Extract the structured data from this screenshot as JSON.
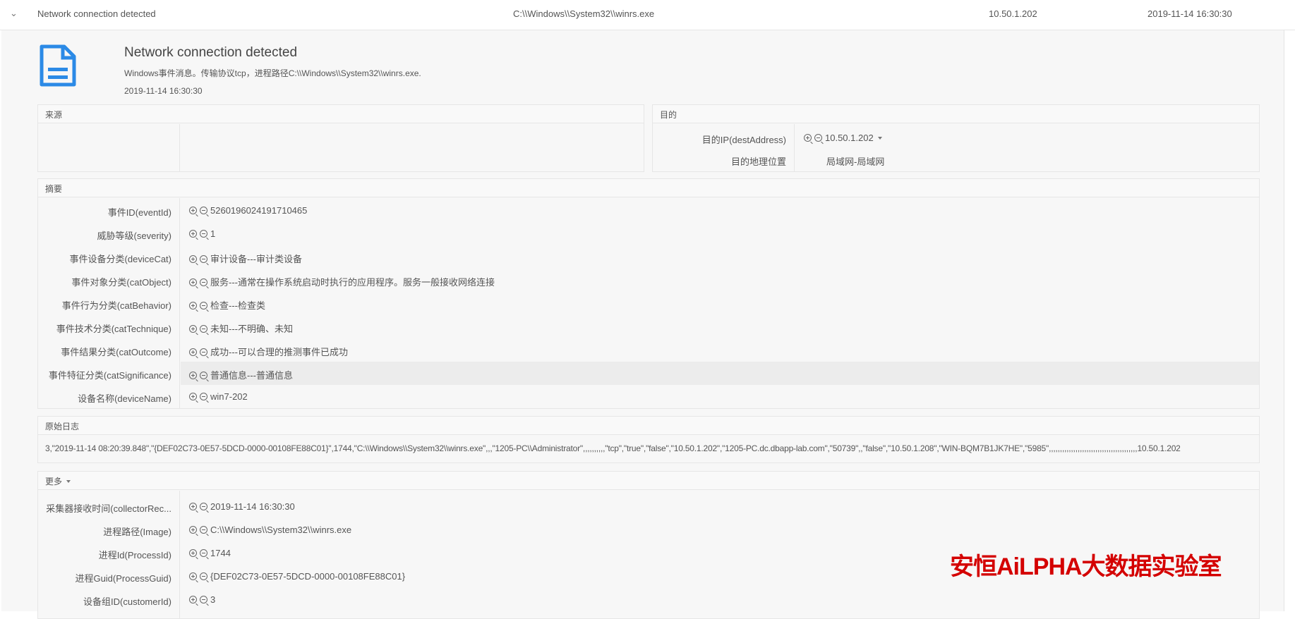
{
  "row": {
    "title": "Network connection detected",
    "path": "C:\\\\Windows\\\\System32\\\\winrs.exe",
    "ip": "10.50.1.202",
    "time": "2019-11-14 16:30:30"
  },
  "header": {
    "title": "Network connection detected",
    "description": "Windows事件消息。传输协议tcp，进程路径C:\\\\Windows\\\\System32\\\\winrs.exe.",
    "time": "2019-11-14 16:30:30",
    "icon": "document-icon",
    "icon_color": "#2b8ae6"
  },
  "source": {
    "title": "来源"
  },
  "dest": {
    "title": "目的",
    "fields": [
      {
        "label": "目的IP(destAddress)",
        "value": "10.50.1.202"
      },
      {
        "label": "目的地理位置",
        "value": "局域网-局域网"
      }
    ]
  },
  "summary": {
    "title": "摘要",
    "fields": [
      {
        "label": "事件ID(eventId)",
        "value": "5260196024191710465"
      },
      {
        "label": "威胁等级(severity)",
        "value": "1"
      },
      {
        "label": "事件设备分类(deviceCat)",
        "value": "审计设备---审计类设备"
      },
      {
        "label": "事件对象分类(catObject)",
        "value": "服务---通常在操作系统启动时执行的应用程序。服务一般接收网络连接"
      },
      {
        "label": "事件行为分类(catBehavior)",
        "value": "检查---检查类"
      },
      {
        "label": "事件技术分类(catTechnique)",
        "value": "未知---不明确、未知"
      },
      {
        "label": "事件结果分类(catOutcome)",
        "value": "成功---可以合理的推测事件已成功"
      },
      {
        "label": "事件特征分类(catSignificance)",
        "value": "普通信息---普通信息"
      },
      {
        "label": "设备名称(deviceName)",
        "value": "win7-202"
      }
    ]
  },
  "rawlog": {
    "title": "原始日志",
    "text": "3,\"2019-11-14 08:20:39.848\",\"{DEF02C73-0E57-5DCD-0000-00108FE88C01}\",1744,\"C:\\\\Windows\\\\System32\\\\winrs.exe\",,,\"1205-PC\\\\Administrator\",,,,,,,,,,\"tcp\",\"true\",\"false\",\"10.50.1.202\",\"1205-PC.dc.dbapp-lab.com\",\"50739\",,\"false\",\"10.50.1.208\",\"WIN-BQM7B1JK7HE\",\"5985\",,,,,,,,,,,,,,,,,,,,,,,,,,,,,,,,,,,,,,,,10.50.1.202"
  },
  "more": {
    "title": "更多",
    "fields": [
      {
        "label": "采集器接收时间(collectorRec...",
        "value": "2019-11-14 16:30:30"
      },
      {
        "label": "进程路径(Image)",
        "value": "C:\\\\Windows\\\\System32\\\\winrs.exe"
      },
      {
        "label": "进程Id(ProcessId)",
        "value": "1744"
      },
      {
        "label": "进程Guid(ProcessGuid)",
        "value": "{DEF02C73-0E57-5DCD-0000-00108FE88C01}"
      },
      {
        "label": "设备组ID(customerId)",
        "value": "3"
      }
    ]
  },
  "watermark": "安恒AiLPHA大数据实验室"
}
